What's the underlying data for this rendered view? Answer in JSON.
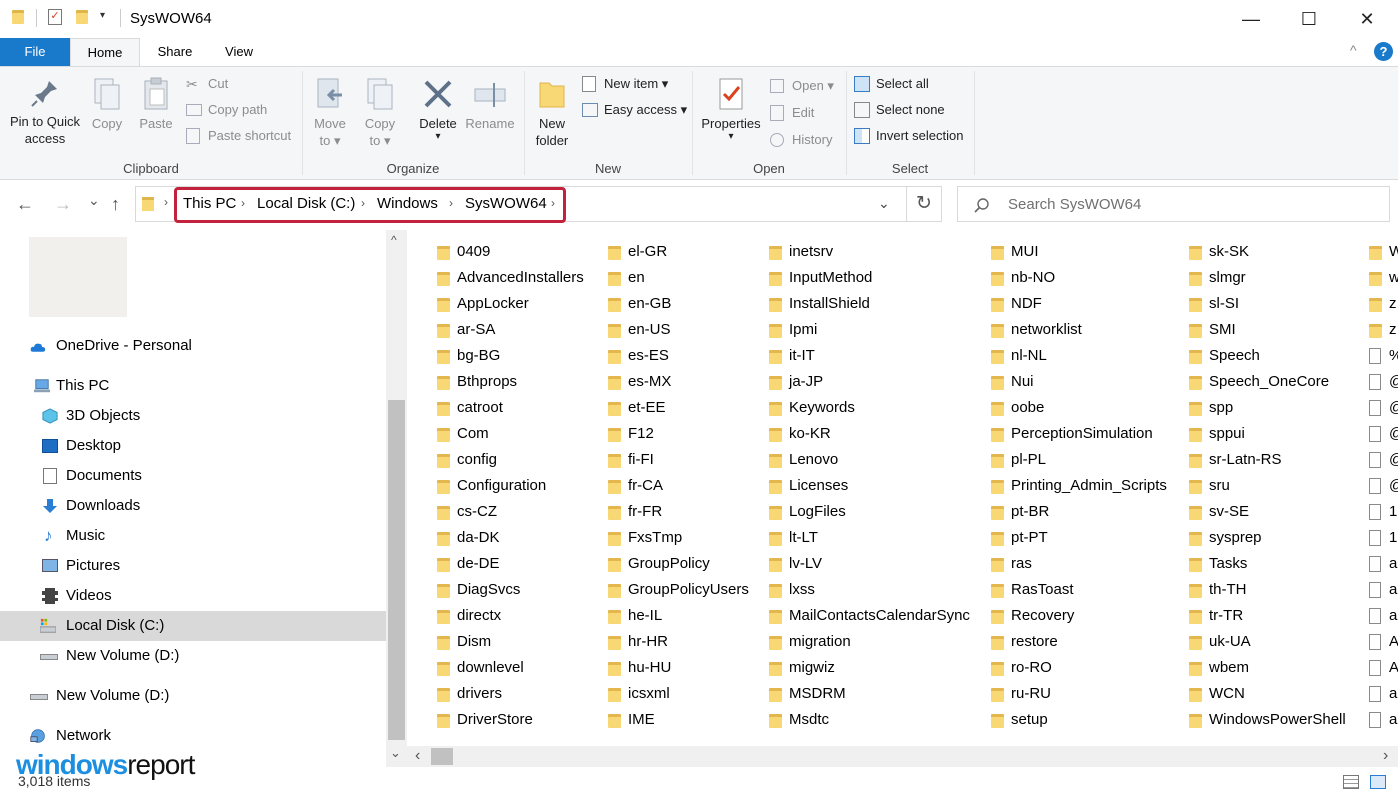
{
  "window": {
    "title": "SysWOW64",
    "minimize_glyph": "—",
    "maximize_glyph": "☐",
    "close_glyph": "✕"
  },
  "ribbon_tabs": [
    "File",
    "Home",
    "Share",
    "View"
  ],
  "help_glyph": "?",
  "collapse_glyph": "^",
  "clipboard": {
    "pin_label_1": "Pin to Quick",
    "pin_label_2": "access",
    "copy": "Copy",
    "paste": "Paste",
    "cut": "Cut",
    "copy_path": "Copy path",
    "paste_shortcut": "Paste shortcut",
    "group": "Clipboard"
  },
  "organize": {
    "move_to_1": "Move",
    "move_to_2": "to ▾",
    "copy_to_1": "Copy",
    "copy_to_2": "to ▾",
    "delete": "Delete",
    "delete_arrow": "▾",
    "rename": "Rename",
    "group": "Organize"
  },
  "new": {
    "new_folder_1": "New",
    "new_folder_2": "folder",
    "new_item": "New item ▾",
    "easy_access": "Easy access ▾",
    "group": "New"
  },
  "open": {
    "properties": "Properties",
    "properties_arrow": "▾",
    "open": "Open ▾",
    "edit": "Edit",
    "history": "History",
    "group": "Open"
  },
  "select": {
    "select_all": "Select all",
    "select_none": "Select none",
    "invert": "Invert selection",
    "group": "Select"
  },
  "nav_buttons": {
    "back": "←",
    "forward": "→",
    "recent": "⌄",
    "up": "↑",
    "refresh": "↻",
    "dropdown": "⌄"
  },
  "breadcrumb": [
    "This PC",
    "Local Disk (C:)",
    "Windows",
    "SysWOW64"
  ],
  "breadcrumb_sep": "›",
  "search_placeholder": "Search SysWOW64",
  "nav_pane": [
    {
      "label": "OneDrive - Personal",
      "icon": "onedrive-icon"
    },
    {
      "label": "This PC",
      "icon": "computer-icon"
    },
    {
      "label": "3D Objects",
      "icon": "3d-objects-icon"
    },
    {
      "label": "Desktop",
      "icon": "desktop-icon"
    },
    {
      "label": "Documents",
      "icon": "documents-icon"
    },
    {
      "label": "Downloads",
      "icon": "downloads-icon"
    },
    {
      "label": "Music",
      "icon": "music-icon"
    },
    {
      "label": "Pictures",
      "icon": "pictures-icon"
    },
    {
      "label": "Videos",
      "icon": "videos-icon"
    },
    {
      "label": "Local Disk (C:)",
      "icon": "local-disk-icon",
      "selected": true
    },
    {
      "label": "New Volume (D:)",
      "icon": "drive-icon"
    },
    {
      "label": "New Volume (D:)",
      "icon": "drive-icon"
    },
    {
      "label": "Network",
      "icon": "network-icon"
    }
  ],
  "columns": [
    [
      "0409",
      "AdvancedInstallers",
      "AppLocker",
      "ar-SA",
      "bg-BG",
      "Bthprops",
      "catroot",
      "Com",
      "config",
      "Configuration",
      "cs-CZ",
      "da-DK",
      "de-DE",
      "DiagSvcs",
      "directx",
      "Dism",
      "downlevel",
      "drivers",
      "DriverStore"
    ],
    [
      "el-GR",
      "en",
      "en-GB",
      "en-US",
      "es-ES",
      "es-MX",
      "et-EE",
      "F12",
      "fi-FI",
      "fr-CA",
      "fr-FR",
      "FxsTmp",
      "GroupPolicy",
      "GroupPolicyUsers",
      "he-IL",
      "hr-HR",
      "hu-HU",
      "icsxml",
      "IME"
    ],
    [
      "inetsrv",
      "InputMethod",
      "InstallShield",
      "Ipmi",
      "it-IT",
      "ja-JP",
      "Keywords",
      "ko-KR",
      "Lenovo",
      "Licenses",
      "LogFiles",
      "lt-LT",
      "lv-LV",
      "lxss",
      "MailContactsCalendarSync",
      "migration",
      "migwiz",
      "MSDRM",
      "Msdtc"
    ],
    [
      "MUI",
      "nb-NO",
      "NDF",
      "networklist",
      "nl-NL",
      "Nui",
      "oobe",
      "PerceptionSimulation",
      "pl-PL",
      "Printing_Admin_Scripts",
      "pt-BR",
      "pt-PT",
      "ras",
      "RasToast",
      "Recovery",
      "restore",
      "ro-RO",
      "ru-RU",
      "setup"
    ],
    [
      "sk-SK",
      "slmgr",
      "sl-SI",
      "SMI",
      "Speech",
      "Speech_OneCore",
      "spp",
      "sppui",
      "sr-Latn-RS",
      "sru",
      "sv-SE",
      "sysprep",
      "Tasks",
      "th-TH",
      "tr-TR",
      "uk-UA",
      "wbem",
      "WCN",
      "WindowsPowerShell"
    ],
    [
      "W",
      "w",
      "z",
      "z",
      "%",
      "@",
      "@",
      "@",
      "@",
      "@",
      "1",
      "1",
      "a",
      "a",
      "a",
      "A",
      "A",
      "a",
      "a"
    ]
  ],
  "scroll_glyphs": {
    "up": "^",
    "down": "⌄",
    "left": "‹",
    "right": "›"
  },
  "status": {
    "items": "3,018 items"
  },
  "watermark": {
    "part1": "windows",
    "part2": "report"
  },
  "colors": {
    "accent": "#1979ca",
    "highlight": "#c3223c",
    "folder": "#f8d775"
  }
}
